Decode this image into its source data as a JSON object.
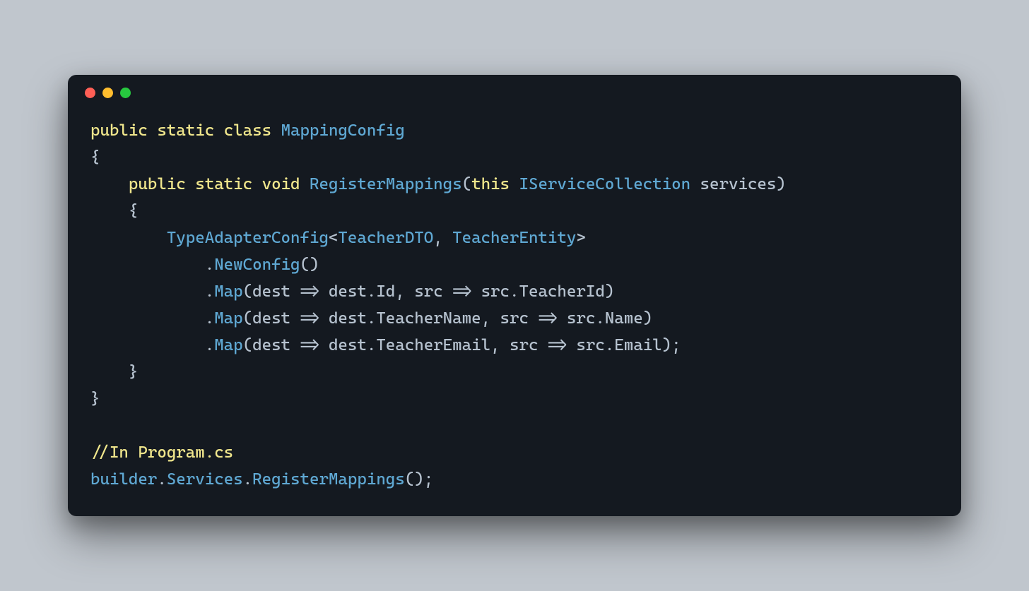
{
  "code": {
    "line1": {
      "kw1": "public",
      "kw2": "static",
      "kw3": "class",
      "type": "MappingConfig"
    },
    "line2": {
      "brace": "{"
    },
    "line3": {
      "kw1": "public",
      "kw2": "static",
      "kw3": "void",
      "method": "RegisterMappings",
      "paren1": "(",
      "kw4": "this",
      "type": "IServiceCollection",
      "param": "services",
      "paren2": ")"
    },
    "line4": {
      "brace": "{"
    },
    "line5": {
      "type": "TypeAdapterConfig",
      "lt": "<",
      "type1": "TeacherDTO",
      "comma": ", ",
      "type2": "TeacherEntity",
      "gt": ">"
    },
    "line6": {
      "dot": ".",
      "method": "NewConfig",
      "parens": "()"
    },
    "line7": {
      "dot": ".",
      "method": "Map",
      "paren1": "(",
      "p1": "dest",
      "arrow1": " => ",
      "p2": "dest",
      "dot2": ".",
      "prop1": "Id",
      "comma": ", ",
      "p3": "src",
      "arrow2": " => ",
      "p4": "src",
      "dot3": ".",
      "prop2": "TeacherId",
      "paren2": ")"
    },
    "line8": {
      "dot": ".",
      "method": "Map",
      "paren1": "(",
      "p1": "dest",
      "arrow1": " => ",
      "p2": "dest",
      "dot2": ".",
      "prop1": "TeacherName",
      "comma": ", ",
      "p3": "src",
      "arrow2": " => ",
      "p4": "src",
      "dot3": ".",
      "prop2": "Name",
      "paren2": ")"
    },
    "line9": {
      "dot": ".",
      "method": "Map",
      "paren1": "(",
      "p1": "dest",
      "arrow1": " => ",
      "p2": "dest",
      "dot2": ".",
      "prop1": "TeacherEmail",
      "comma": ", ",
      "p3": "src",
      "arrow2": " => ",
      "p4": "src",
      "dot3": ".",
      "prop2": "Email",
      "paren2": ");"
    },
    "line10": {
      "brace": "}"
    },
    "line11": {
      "brace": "}"
    },
    "line13": {
      "comment": "//In Program.cs"
    },
    "line14": {
      "var": "builder",
      "dot1": ".",
      "prop": "Services",
      "dot2": ".",
      "method": "RegisterMappings",
      "parens": "();"
    }
  },
  "colors": {
    "background": "#c0c6cd",
    "window": "#141920",
    "keyword": "#f0e68c",
    "type": "#5fa8d3",
    "default": "#b6c2cf",
    "red": "#ff5f56",
    "yellow": "#ffbd2e",
    "green": "#27c93f"
  }
}
